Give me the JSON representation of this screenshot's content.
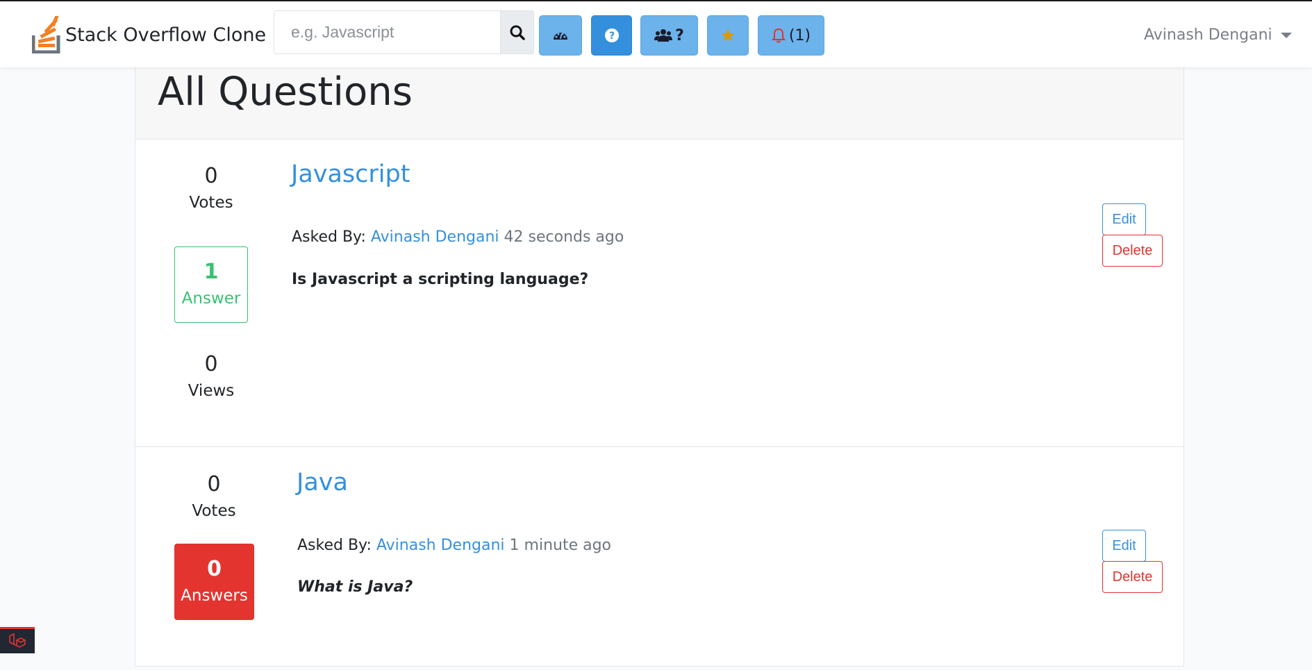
{
  "app": {
    "name": "Stack Overflow Clone"
  },
  "search": {
    "placeholder": "e.g. Javascript"
  },
  "nav": {
    "dashboard_icon": "dashboard-icon",
    "ask_icon": "question-circle-icon",
    "users_question": "?",
    "favorites_icon": "star-icon",
    "notifications_count": "(1)",
    "user_name": "Avinash Dengani"
  },
  "page": {
    "title": "All Questions"
  },
  "questions": [
    {
      "votes": "0",
      "votes_label": "Votes",
      "answers": "1",
      "answers_label": "Answer",
      "views": "0",
      "views_label": "Views",
      "title": "Javascript",
      "asked_by_label": "Asked By:",
      "author": "Avinash Dengani",
      "ago": "42 seconds ago",
      "body": "Is Javascript a scripting language?",
      "edit_label": "Edit",
      "delete_label": "Delete"
    },
    {
      "votes": "0",
      "votes_label": "Votes",
      "answers": "0",
      "answers_label": "Answers",
      "title": "Java",
      "asked_by_label": "Asked By:",
      "author": "Avinash Dengani",
      "ago": "1 minute ago",
      "body": "What is Java?",
      "edit_label": "Edit",
      "delete_label": "Delete"
    }
  ],
  "colors": {
    "primary": "#3490dc",
    "info": "#6cb2eb",
    "success": "#38c172",
    "danger": "#e3342f",
    "brand_orange": "#f48024"
  }
}
